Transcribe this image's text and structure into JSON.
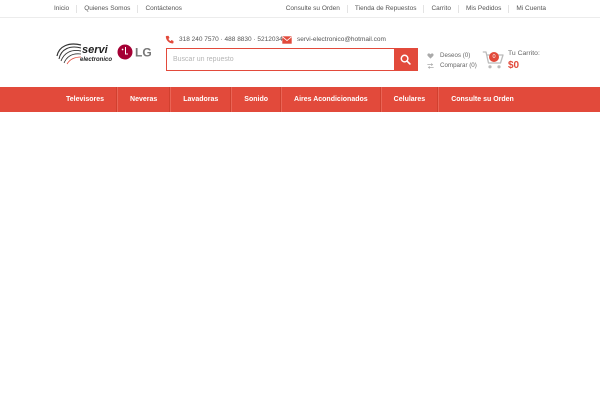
{
  "topbar": {
    "left_links": [
      "Inicio",
      "Quienes Somos",
      "Contáctenos"
    ],
    "right_links": [
      "Consulte su Orden",
      "Tienda de Repuestos",
      "Carrito",
      "Mis Pedidos",
      "Mi Cuenta"
    ]
  },
  "header": {
    "logo": {
      "brand": "servi",
      "sub": "electronico",
      "partner": "LG"
    },
    "phone": "318 240 7570 · 488 8830 · 5212034",
    "email": "servi-electronico@hotmail.com",
    "search": {
      "placeholder": "Buscar un repuesto",
      "value": ""
    },
    "wishlist_label": "Deseos (0)",
    "compare_label": "Comparar (0)",
    "cart": {
      "count": "0",
      "label": "Tu Carrito:",
      "total": "$0"
    }
  },
  "nav": {
    "items": [
      "Televisores",
      "Neveras",
      "Lavadoras",
      "Sonido",
      "Aires Acondicionados",
      "Celulares",
      "Consulte su Orden"
    ]
  },
  "colors": {
    "accent": "#e24a3b",
    "lg_red": "#a50034"
  }
}
